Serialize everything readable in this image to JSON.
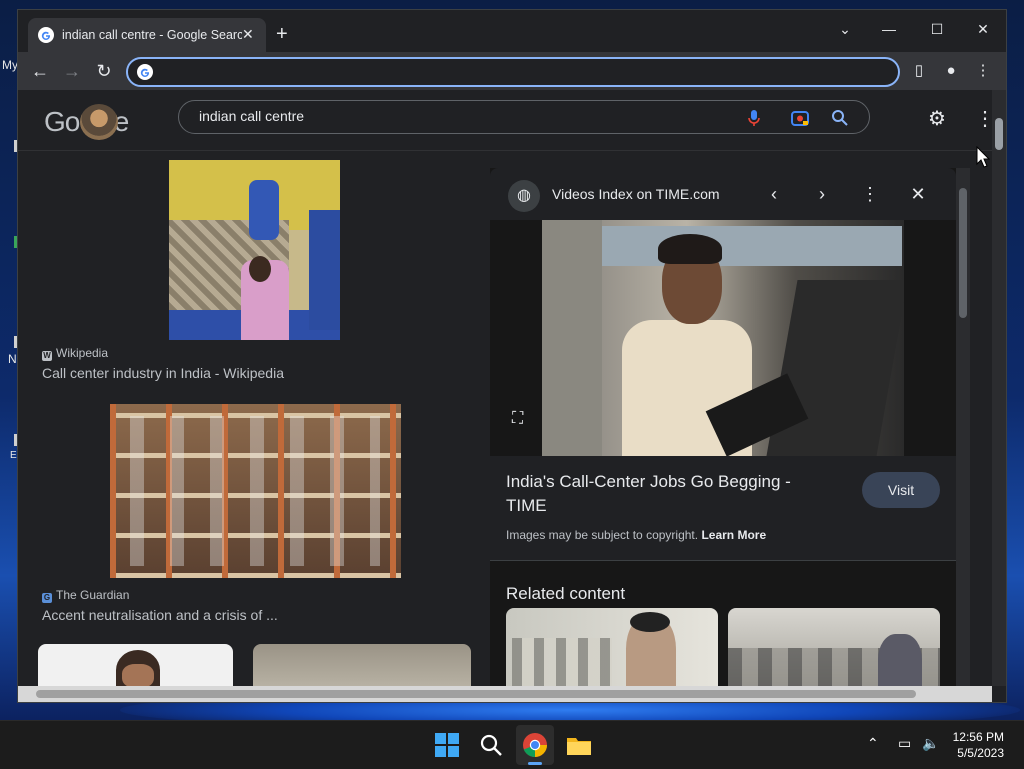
{
  "desktop": {
    "labels": [
      "My",
      "N",
      "E"
    ]
  },
  "browser": {
    "tab_title": "indian call centre - Google Search",
    "tab_close": "✕",
    "new_tab": "+",
    "address_value": "",
    "window_controls": {
      "minimize": "—",
      "maximize": "☐",
      "close": "✕",
      "tab_search": "⌄"
    }
  },
  "google": {
    "logo_text": "Google",
    "query": "indian call centre"
  },
  "results": [
    {
      "source": "Wikipedia",
      "source_icon": "W",
      "title": "Call center industry in India - Wikipedia"
    },
    {
      "source": "The Guardian",
      "source_icon": "G",
      "title": "Accent neutralisation and a crisis of ..."
    }
  ],
  "panel": {
    "site": "Videos Index on TIME.com",
    "headline": "India's Call-Center Jobs Go Begging - TIME",
    "visit_label": "Visit",
    "copyright_text": "Images may be subject to copyright.",
    "learn_more": "Learn More",
    "related_heading": "Related content"
  },
  "taskbar": {
    "time": "12:56 PM",
    "date": "5/5/2023"
  },
  "colors": {
    "accent": "#8ab4f8",
    "page_bg": "#202124",
    "visit_bg": "#394457"
  }
}
